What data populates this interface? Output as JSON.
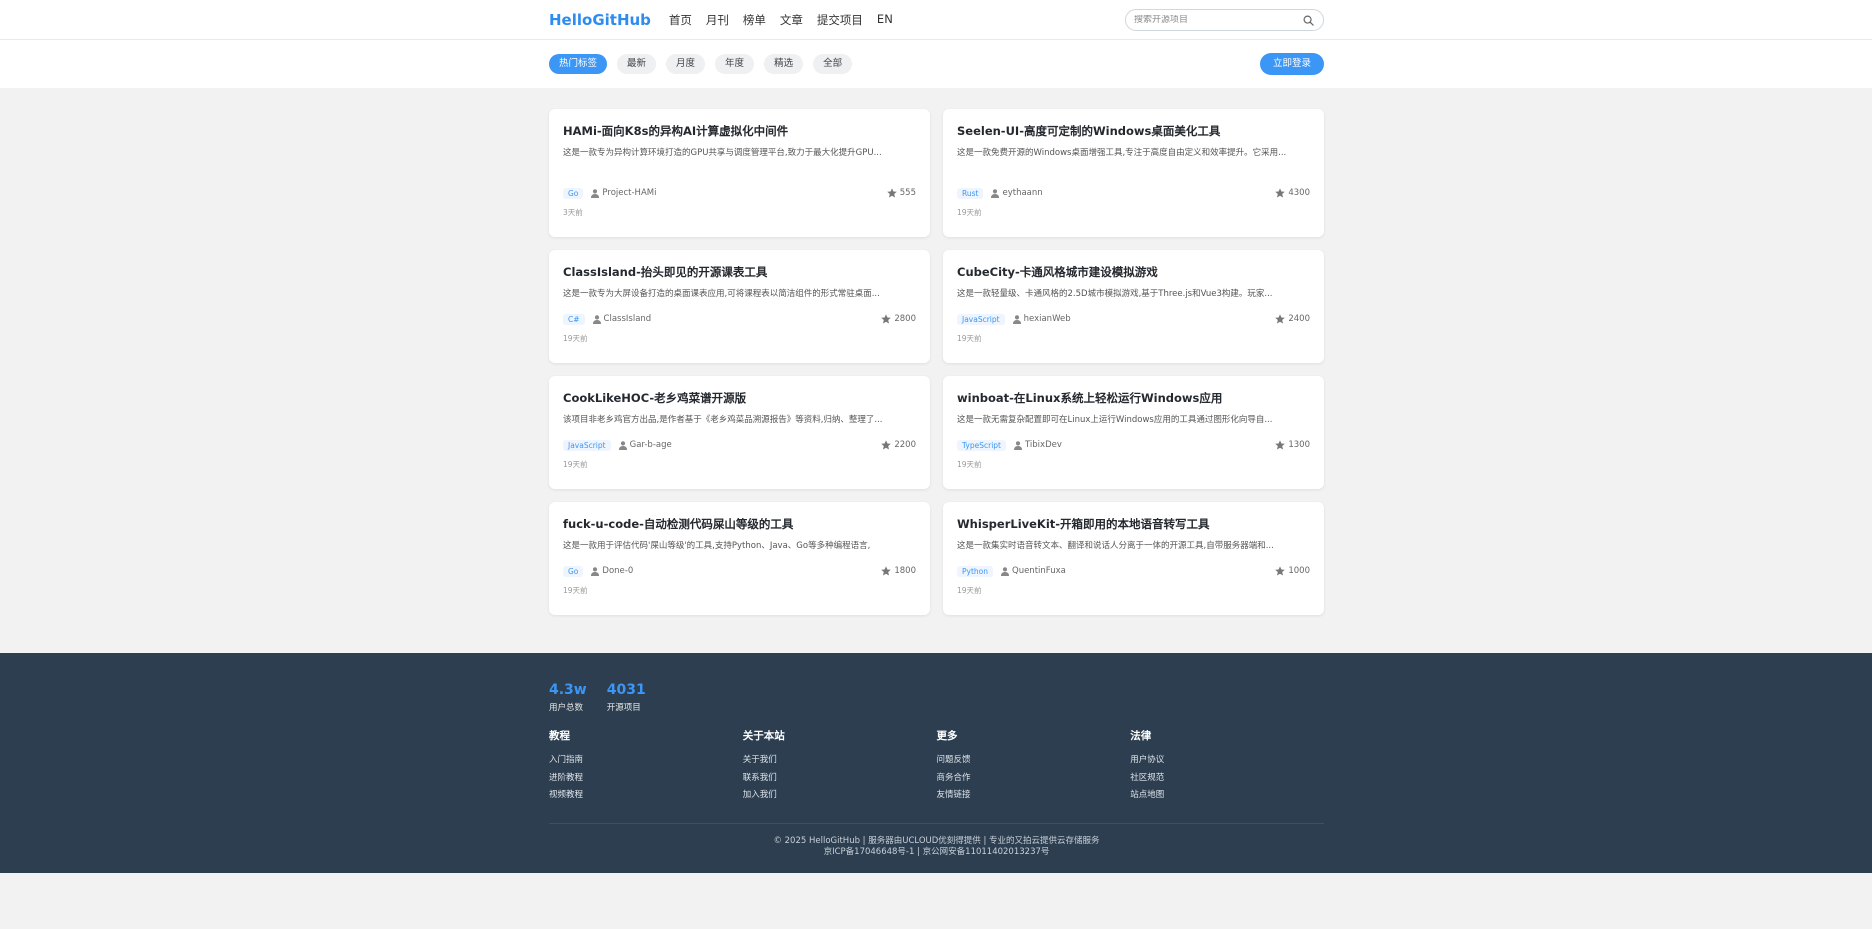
{
  "header": {
    "logo": "HelloGitHub",
    "nav": [
      "首页",
      "月刊",
      "榜单",
      "文章",
      "提交项目",
      "EN"
    ],
    "search_placeholder": "搜索开源项目"
  },
  "filters": {
    "tags": [
      "热门标签",
      "最新",
      "月度",
      "年度",
      "精选",
      "全部"
    ],
    "login_label": "立即登录"
  },
  "cards": [
    {
      "title": "HAMi-面向K8s的异构AI计算虚拟化中间件",
      "desc": "这是一款专为异构计算环境打造的GPU共享与调度管理平台,致力于最大化提升GPU...",
      "lang": "Go",
      "author": "Project-HAMi",
      "stars": "555",
      "time": "3天前"
    },
    {
      "title": "Seelen-UI-高度可定制的Windows桌面美化工具",
      "desc": "这是一款免费开源的Windows桌面增强工具,专注于高度自由定义和效率提升。它采用...",
      "lang": "Rust",
      "author": "eythaann",
      "stars": "4300",
      "time": "19天前"
    },
    {
      "title": "ClassIsland-抬头即见的开源课表工具",
      "desc": "这是一款专为大屏设备打造的桌面课表应用,可将课程表以简洁组件的形式常驻桌面...",
      "lang": "C#",
      "author": "ClassIsland",
      "stars": "2800",
      "time": "19天前"
    },
    {
      "title": "CubeCity-卡通风格城市建设模拟游戏",
      "desc": "这是一款轻量级、卡通风格的2.5D城市模拟游戏,基于Three.js和Vue3构建。玩家...",
      "lang": "JavaScript",
      "author": "hexianWeb",
      "stars": "2400",
      "time": "19天前"
    },
    {
      "title": "CookLikeHOC-老乡鸡菜谱开源版",
      "desc": "该项目非老乡鸡官方出品,是作者基于《老乡鸡菜品溯源报告》等资料,归纳、整理了...",
      "lang": "JavaScript",
      "author": "Gar-b-age",
      "stars": "2200",
      "time": "19天前"
    },
    {
      "title": "winboat-在Linux系统上轻松运行Windows应用",
      "desc": "这是一款无需复杂配置即可在Linux上运行Windows应用的工具通过图形化向导自...",
      "lang": "TypeScript",
      "author": "TibixDev",
      "stars": "1300",
      "time": "19天前"
    },
    {
      "title": "fuck-u-code-自动检测代码屎山等级的工具",
      "desc": "这是一款用于评估代码'屎山等级'的工具,支持Python、Java、Go等多种编程语言,",
      "lang": "Go",
      "author": "Done-0",
      "stars": "1800",
      "time": "19天前"
    },
    {
      "title": "WhisperLiveKit-开箱即用的本地语音转写工具",
      "desc": "这是一款集实时语音转文本、翻译和说话人分离于一体的开源工具,自带服务器端和...",
      "lang": "Python",
      "author": "QuentinFuxa",
      "stars": "1000",
      "time": "19天前"
    }
  ],
  "footer": {
    "stats": [
      {
        "num": "4.3w",
        "label": "用户总数"
      },
      {
        "num": "4031",
        "label": "开源项目"
      }
    ],
    "columns": [
      {
        "title": "教程",
        "links": [
          "入门指南",
          "进阶教程",
          "视频教程"
        ]
      },
      {
        "title": "关于本站",
        "links": [
          "关于我们",
          "联系我们",
          "加入我们"
        ]
      },
      {
        "title": "更多",
        "links": [
          "问题反馈",
          "商务合作",
          "友情链接"
        ]
      },
      {
        "title": "法律",
        "links": [
          "用户协议",
          "社区规范",
          "站点地图"
        ]
      }
    ],
    "copyright_line1": "© 2025 HelloGitHub | 服务器由UCLOUD优刻得提供 | 专业的又拍云提供云存储服务",
    "copyright_line2": "京ICP备17046648号-1 | 京公网安备11011402013237号"
  }
}
